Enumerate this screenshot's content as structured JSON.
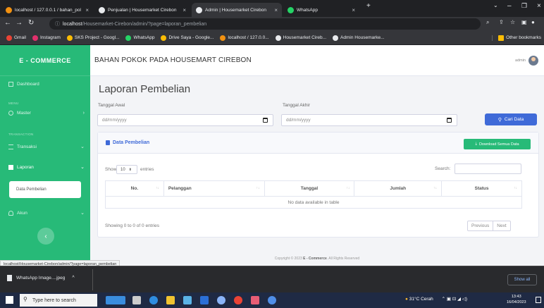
{
  "browser": {
    "tabs": [
      {
        "title": "localhost / 127.0.0.1 / bahan_pol",
        "favicon": "phpmyadmin-icon"
      },
      {
        "title": "Penjualan | Housemarket Cirebon",
        "favicon": "globe-icon"
      },
      {
        "title": "Admin | Housemarket Cirebon",
        "favicon": "globe-icon"
      },
      {
        "title": "WhatsApp",
        "favicon": "whatsapp-icon"
      }
    ],
    "url_host": "localhost",
    "url_path": "/Housemarket-Cirebon/admin/?page=laporan_pembelian",
    "bookmarks": [
      "Gmail",
      "Instagram",
      "SKS Project - Googl...",
      "WhatsApp",
      "Drive Saya - Google...",
      "localhost / 127.0.0...",
      "Housemarket Cireb...",
      "Admin Housemarke..."
    ],
    "other_bookmarks": "Other bookmarks",
    "status_url": "localhost/Housemarket-Cirebon/admin/?page=laporan_pembelian"
  },
  "sidebar": {
    "brand": "E - COMMERCE",
    "dashboard": "Dashboard",
    "heading_menu": "MENU",
    "master": "Master",
    "heading_transaction": "TRANSACTION",
    "transaksi": "Transaksi",
    "laporan": "Laporan",
    "data_pembelian": "Data Pembelian",
    "akun": "Akun",
    "toggle_icon": "chevron-left-icon"
  },
  "header": {
    "title": "BAHAN POKOK PADA HOUSEMART CIREBON",
    "user": "admin"
  },
  "main": {
    "page_title": "Laporan Pembelian",
    "tanggal_awal_label": "Tanggal Awal",
    "tanggal_akhir_label": "Tanggal Akhir",
    "date_placeholder": "dd/mm/yyyy",
    "cari_button": "Cari Data",
    "card_title": "Data Pembelian",
    "download_button": "Download Semua Data",
    "show_label": "Show",
    "entries_value": "10",
    "entries_label": "entries",
    "search_label": "Search:",
    "columns": [
      "No.",
      "Pelanggan",
      "Tanggal",
      "Jumlah",
      "Status"
    ],
    "empty_message": "No data available in table",
    "info": "Showing 0 to 0 of 0 entries",
    "previous": "Previous",
    "next": "Next",
    "footer_prefix": "Copyright © 2023",
    "footer_brand": "E - Commerce",
    "footer_suffix": ". All Rights Reserved"
  },
  "downloads": {
    "file": "WhatsApp Image....jpeg",
    "show_all": "Show all"
  },
  "taskbar": {
    "search_placeholder": "Type here to search",
    "weather": "31°C  Cerah",
    "time": "13:43",
    "date": "16/04/2023"
  },
  "colors": {
    "sidebar": "#27ba78",
    "primary": "#3f6ad8"
  }
}
